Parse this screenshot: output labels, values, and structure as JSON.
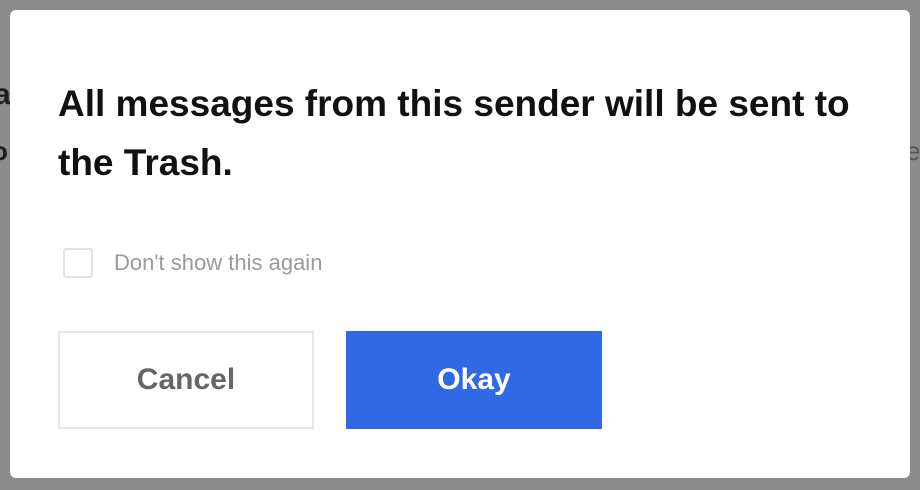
{
  "background": {
    "fragment_left_top": "a",
    "fragment_left_bottom": "o",
    "fragment_right": "e"
  },
  "dialog": {
    "message": "All messages from this sender will be sent to the Trash.",
    "checkbox": {
      "label": "Don't show this again",
      "checked": false
    },
    "buttons": {
      "cancel_label": "Cancel",
      "okay_label": "Okay"
    }
  },
  "colors": {
    "primary": "#3068e6",
    "overlay": "#8c8c8c"
  }
}
